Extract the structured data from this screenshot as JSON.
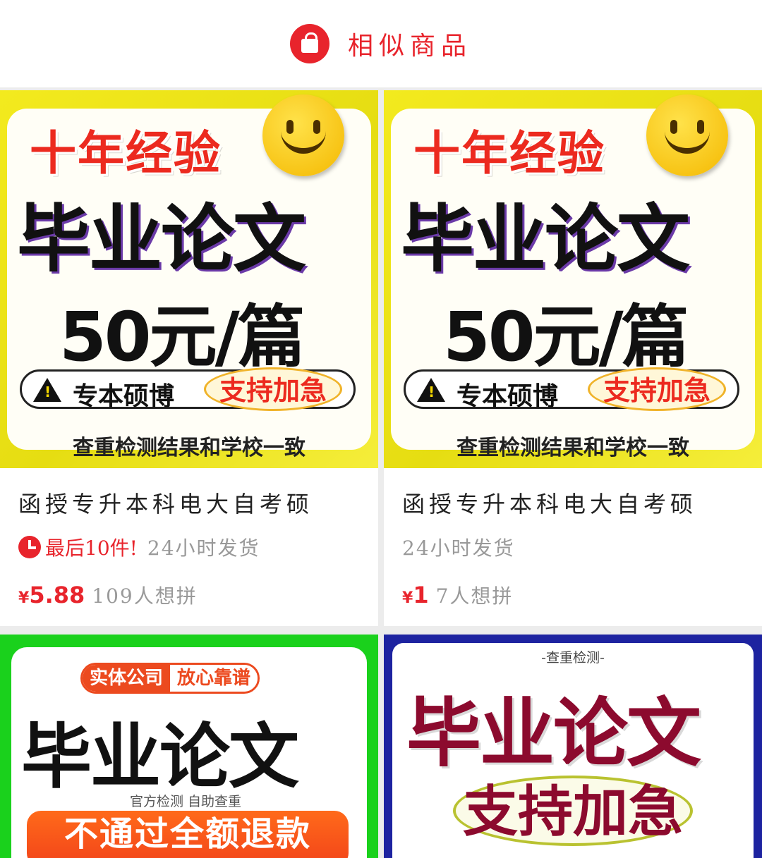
{
  "header": {
    "title": "相似商品",
    "icon": "shopping-bag-icon",
    "accent": "#e8242c"
  },
  "products": [
    {
      "poster": {
        "experience": "十年经验",
        "headline": "毕业论文",
        "price_text": "50元/篇",
        "levels": "专本硕博",
        "rush": "支持加急",
        "check": "查重检测结果和学校一致"
      },
      "name": "函授专升本科电大自考硕",
      "urgent": "最后10件!",
      "shipping": "24小时发货",
      "currency": "¥",
      "price": "5.88",
      "want": "109人想拼"
    },
    {
      "poster": {
        "experience": "十年经验",
        "headline": "毕业论文",
        "price_text": "50元/篇",
        "levels": "专本硕博",
        "rush": "支持加急",
        "check": "查重检测结果和学校一致"
      },
      "name": "函授专升本科电大自考硕",
      "shipping": "24小时发货",
      "currency": "¥",
      "price": "1",
      "want": "7人想拼"
    },
    {
      "poster": {
        "badge_left": "实体公司",
        "badge_right": "放心靠谱",
        "headline": "毕业论文",
        "sub": "官方检测 自助查重",
        "refund": "不通过全额退款"
      }
    },
    {
      "poster": {
        "label": "-查重检测-",
        "headline": "毕业论文",
        "rush": "支持加急"
      }
    }
  ]
}
